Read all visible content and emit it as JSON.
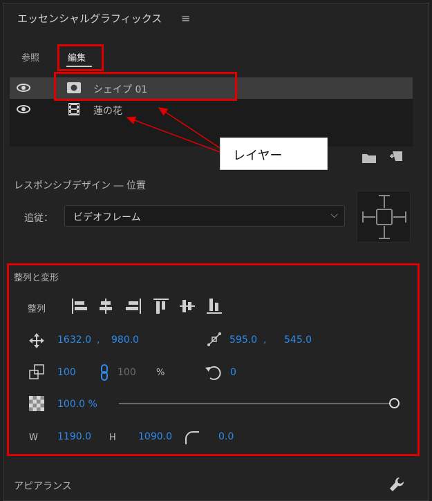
{
  "panel": {
    "title": "エッセンシャルグラフィックス"
  },
  "tabs": [
    {
      "label": "参照",
      "active": false
    },
    {
      "label": "編集",
      "active": true
    }
  ],
  "layers": [
    {
      "name": "シェイプ 01",
      "icon": "shape-icon",
      "selected": true
    },
    {
      "name": "蓮の花",
      "icon": "film-icon",
      "selected": false
    }
  ],
  "callout": {
    "text": "レイヤー"
  },
  "responsive": {
    "title": "レスポンシブデザイン ― 位置",
    "follow_label": "追従：",
    "follow_value": "ビデオフレーム"
  },
  "align_transform": {
    "title": "整列と変形",
    "align_label": "整列",
    "position_x": "1632.0",
    "position_sep": ",",
    "position_y": "980.0",
    "anchor_x": "595.0",
    "anchor_sep": ",",
    "anchor_y": "545.0",
    "scale": "100",
    "scale_linked": "100",
    "scale_unit": "%",
    "rotation": "0",
    "opacity": "100.0 %",
    "opacity_fraction": 1.0,
    "w_label": "W",
    "width": "1190.0",
    "h_label": "H",
    "height": "1090.0",
    "corner_radius": "0.0"
  },
  "appearance": {
    "title": "アピアランス"
  },
  "colors": {
    "accent": "#2d8ceb",
    "highlight_box": "#e00000",
    "panel_bg": "#232323"
  }
}
